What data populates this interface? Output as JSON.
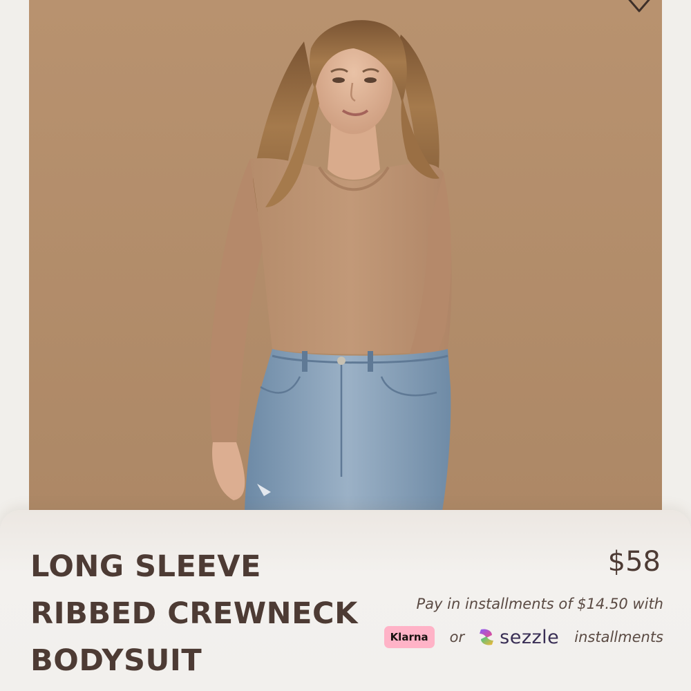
{
  "product": {
    "title_lines": [
      "LONG SLEEVE",
      "RIBBED CREWNECK",
      "BODYSUIT"
    ],
    "price": "$58",
    "image_alt_icon": "product-photo"
  },
  "payment": {
    "installments_text": "Pay in installments of $14.50 with",
    "klarna_label": "Klarna",
    "or_label": "or",
    "sezzle_label": "sezzle",
    "installments_suffix": "installments"
  },
  "icons": {
    "wishlist": "heart-icon",
    "sezzle_logo": "sezzle-logo-icon"
  },
  "colors": {
    "backdrop": "#b48e6c",
    "title_text": "#4d3b34",
    "klarna_pink": "#ffb3c7",
    "sezzle_purple": "#392e55",
    "panel_bg": "#f2f0ed"
  }
}
